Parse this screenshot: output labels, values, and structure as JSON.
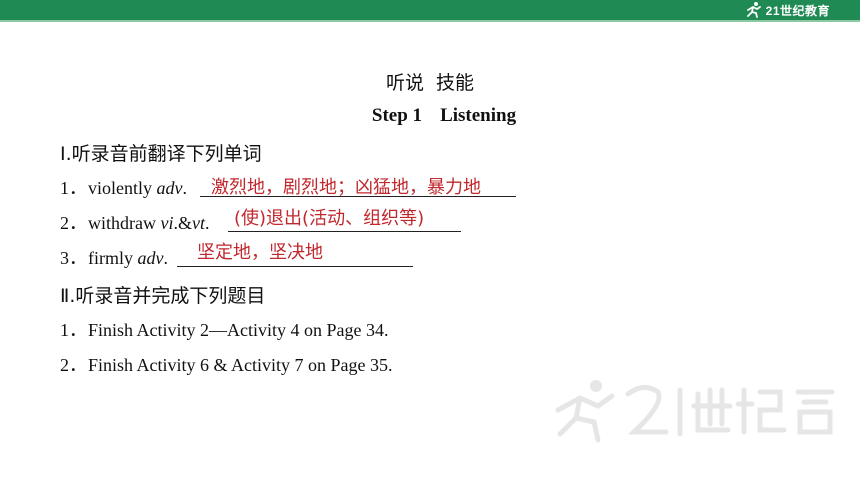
{
  "header": {
    "logo_text": "21世纪教育",
    "logo_icon": "runner-icon",
    "bar_color": "#1f8a53"
  },
  "title": {
    "cn_part1": "听说",
    "cn_part2": "技能",
    "step": "Step 1",
    "step_name": "Listening"
  },
  "section1": {
    "heading": "Ⅰ.听录音前翻译下列单词",
    "items": [
      {
        "num": "1．",
        "word": "violently ",
        "pos": "adv",
        "tail": ".",
        "answer": "激烈地，剧烈地；凶猛地，暴力地"
      },
      {
        "num": "2．",
        "word": "withdraw ",
        "pos": "vi",
        "mid": ".&",
        "pos2": "vt",
        "tail": ".",
        "answer": "(使)退出(活动、组织等)"
      },
      {
        "num": "3．",
        "word": "firmly ",
        "pos": "adv",
        "tail": ".",
        "answer": "坚定地，坚决地"
      }
    ]
  },
  "section2": {
    "heading": "Ⅱ.听录音并完成下列题目",
    "items": [
      {
        "num": "1．",
        "text": "Finish Activity 2—Activity 4 on Page 34."
      },
      {
        "num": "2．",
        "text": "Finish Activity 6 & Activity 7 on Page 35."
      }
    ]
  },
  "colors": {
    "answer": "#c0282d",
    "text": "#111111"
  }
}
